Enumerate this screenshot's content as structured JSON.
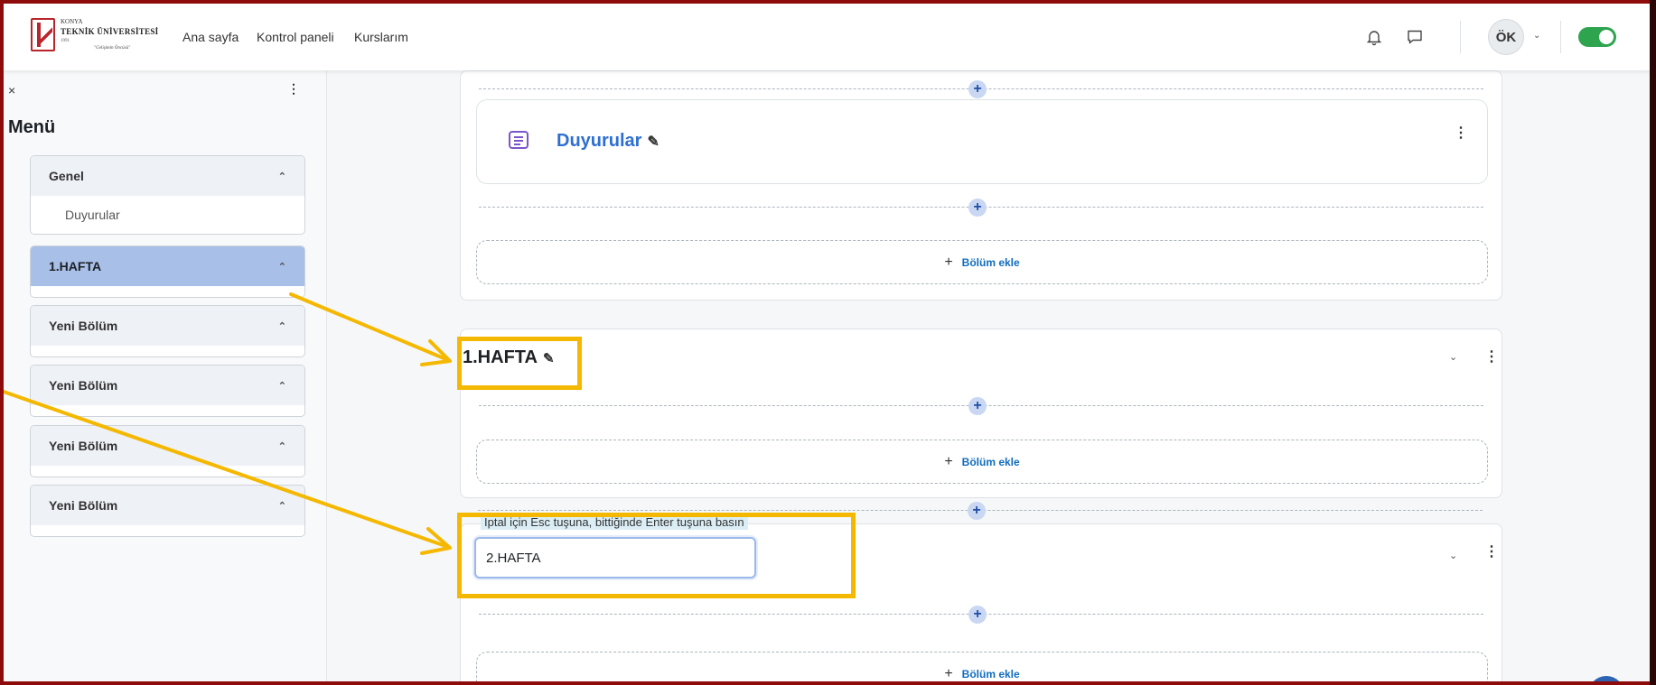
{
  "brand": {
    "line1": "KONYA",
    "line2": "TEKNİK ÜNİVERSİTESİ",
    "line3": "1991",
    "tagline": "\"Gelişimin Öncüsü\""
  },
  "nav": {
    "links": [
      "Ana sayfa",
      "Kontrol paneli",
      "Kurslarım"
    ],
    "icons": [
      "bell-icon",
      "chat-icon"
    ],
    "avatar_initials": "ÖK",
    "edit_mode": "on",
    "accent_color": "#2ea44f"
  },
  "drawer": {
    "close": "×",
    "more": "⋮",
    "title": "Menü",
    "sections": [
      {
        "label": "Genel",
        "items": [
          "Duyurular"
        ],
        "active": false
      },
      {
        "label": "1.HAFTA",
        "items": [],
        "active": true
      },
      {
        "label": "Yeni Bölüm",
        "items": [],
        "active": false
      },
      {
        "label": "Yeni Bölüm",
        "items": [],
        "active": false
      },
      {
        "label": "Yeni Bölüm",
        "items": [],
        "active": false
      },
      {
        "label": "Yeni Bölüm",
        "items": [],
        "active": false
      }
    ]
  },
  "main": {
    "general": {
      "activity_title": "Duyurular",
      "add_section": "Bölüm ekle"
    },
    "week1": {
      "title": "1.HAFTA",
      "add_section": "Bölüm ekle"
    },
    "week2": {
      "hint": "İptal için Esc tuşuna, bittiğinde Enter tuşuna basın",
      "input_value": "2.HAFTA",
      "add_section": "Bölüm ekle"
    },
    "plus": "+",
    "pencil": "✎",
    "kebab": "⋮",
    "caret": "⌄"
  },
  "annotation_color": "#f5b800"
}
